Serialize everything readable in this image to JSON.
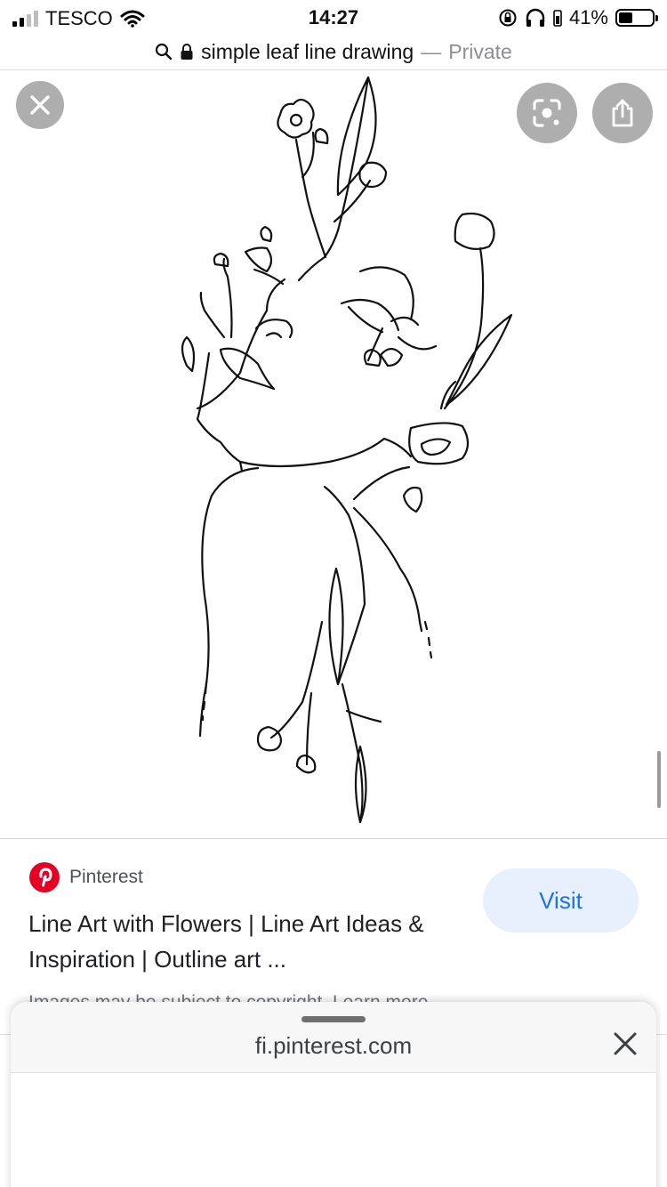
{
  "status": {
    "carrier": "TESCO",
    "time": "14:27",
    "battery": "41%",
    "battery_level": 0.41
  },
  "browser": {
    "query": "simple leaf line drawing",
    "separator": "—",
    "mode": "Private"
  },
  "viewer": {
    "close_icon": "close-icon",
    "lens_icon": "lens-icon",
    "share_icon": "share-icon"
  },
  "result": {
    "source": "Pinterest",
    "title": "Line Art with Flowers | Line Art Ideas & Inspiration | Outline art ...",
    "visit_label": "Visit",
    "copyright": "Images may be subject to copyright. Learn more",
    "accent": "#1a73e8",
    "pinterest_color": "#e60023"
  },
  "sheet": {
    "domain": "fi.pinterest.com",
    "close_icon": "close-icon"
  }
}
